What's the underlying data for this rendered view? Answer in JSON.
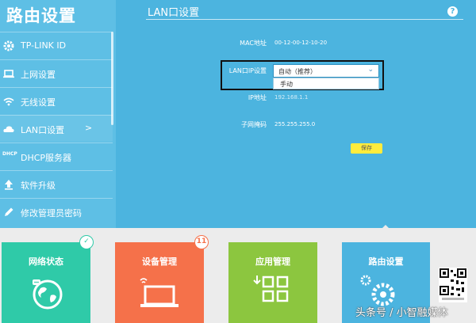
{
  "sidebar": {
    "title": "路由设置",
    "items": [
      {
        "label": "TP-LINK ID",
        "icon": "gear-icon"
      },
      {
        "label": "上网设置",
        "icon": "laptop-icon"
      },
      {
        "label": "无线设置",
        "icon": "wifi-icon"
      },
      {
        "label": "LAN口设置",
        "icon": "cloud-icon",
        "chevron": ">"
      },
      {
        "label": "DHCP服务器",
        "icon": "dhcp-icon",
        "icon_text": "DHCP"
      },
      {
        "label": "软件升级",
        "icon": "upload-icon"
      },
      {
        "label": "修改管理员密码",
        "icon": "pencil-icon"
      }
    ]
  },
  "main": {
    "title": "LAN口设置",
    "help": "?",
    "mac_label": "MAC地址",
    "mac_value": "00-12-00-12-10-20",
    "lan_ip_label": "LAN口IP设置",
    "lan_ip_selected": "自动（推荐）",
    "lan_ip_options": [
      "手动"
    ],
    "ip_label": "IP地址",
    "ip_value": "192.168.1.1",
    "mask_label": "子网掩码",
    "mask_value": "255.255.255.0",
    "save_label": "保存"
  },
  "tiles": [
    {
      "label": "网络状态",
      "color": "#2fcaa8",
      "badge": "✓"
    },
    {
      "label": "设备管理",
      "color": "#f5714a",
      "badge": "11"
    },
    {
      "label": "应用管理",
      "color": "#8cc63f"
    },
    {
      "label": "路由设置",
      "color": "#4cb4df"
    }
  ],
  "watermark": "头条号 / 小智融媒体"
}
